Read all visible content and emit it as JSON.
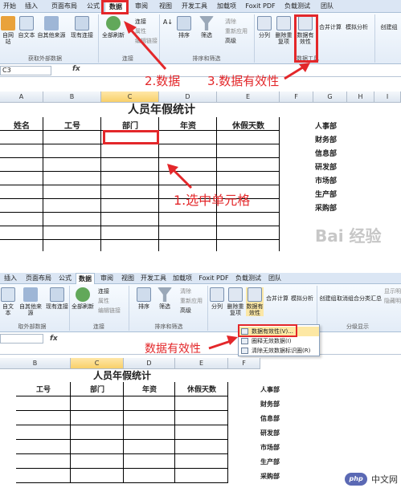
{
  "top": {
    "tabs": [
      "开始",
      "插入",
      "页面布局",
      "公式",
      "数据",
      "审阅",
      "视图",
      "开发工具",
      "加载项",
      "Foxit PDF",
      "负载测试",
      "团队"
    ],
    "active_tab": "数据",
    "ribbon": {
      "get_external": [
        "自网站",
        "自文本",
        "自其他来源",
        "现有连接"
      ],
      "get_external_group": "获取外部数据",
      "refresh_all": "全部刷新",
      "connections_small": [
        "连接",
        "属性",
        "编辑链接"
      ],
      "connections_group": "连接",
      "sort": "排序",
      "filter": "筛选",
      "sort_small": [
        "清除",
        "重新应用",
        "高级"
      ],
      "sort_group": "排序和筛选",
      "split": "分列",
      "remove_dup": "删除重复项",
      "validation": "数据有效性",
      "consolidate": "合并计算",
      "whatif": "模拟分析",
      "tools_group": "数据工具",
      "group": "创建组"
    },
    "namebox": "C3",
    "fx": "fx",
    "col_headers": [
      "A",
      "B",
      "C",
      "D",
      "E",
      "F",
      "G",
      "H",
      "I"
    ],
    "sheet_title": "人员年假统计",
    "table_headers": [
      "姓名",
      "工号",
      "部门",
      "年资",
      "休假天数"
    ],
    "departments": [
      "人事部",
      "财务部",
      "信息部",
      "研发部",
      "市场部",
      "生产部",
      "采购部"
    ],
    "annotations": {
      "step1": "1.选中单元格",
      "step2": "2.数据",
      "step3": "3.数据有效性"
    },
    "watermark": "Bai 经验"
  },
  "bottom": {
    "tabs": [
      "插入",
      "页面布局",
      "公式",
      "数据",
      "审阅",
      "视图",
      "开发工具",
      "加载项",
      "Foxit PDF",
      "负载测试",
      "团队"
    ],
    "active_tab": "数据",
    "ribbon": {
      "get_external": [
        "自文本",
        "自其他来源",
        "现有连接"
      ],
      "get_external_group": "取外部数据",
      "refresh_all": "全部刷新",
      "connections_small": [
        "连接",
        "属性",
        "编辑链接"
      ],
      "connections_group": "连接",
      "sort": "排序",
      "filter": "筛选",
      "sort_small": [
        "清除",
        "重新应用",
        "高级"
      ],
      "sort_group": "排序和筛选",
      "split": "分列",
      "remove_dup": "删除重复项",
      "validation": "数据有效性",
      "consolidate": "合并计算",
      "whatif": "模拟分析",
      "create_group": "创建组",
      "ungroup": "取消组合",
      "subtotal": "分类汇总",
      "outline_small": [
        "显示明细",
        "隐藏明细"
      ],
      "outline_group": "分级显示"
    },
    "dropdown": [
      "数据有效性(V)...",
      "圈释无效数据(I)",
      "清除无效数据标识圈(R)"
    ],
    "annotation": "数据有效性",
    "col_headers": [
      "B",
      "C",
      "D",
      "E",
      "F"
    ],
    "sheet_title": "人员年假统计",
    "table_headers": [
      "工号",
      "部门",
      "年资",
      "休假天数"
    ],
    "departments": [
      "人事部",
      "财务部",
      "信息部",
      "研发部",
      "市场部",
      "生产部",
      "采购部"
    ],
    "brand": "中文网",
    "brand_logo": "php"
  }
}
